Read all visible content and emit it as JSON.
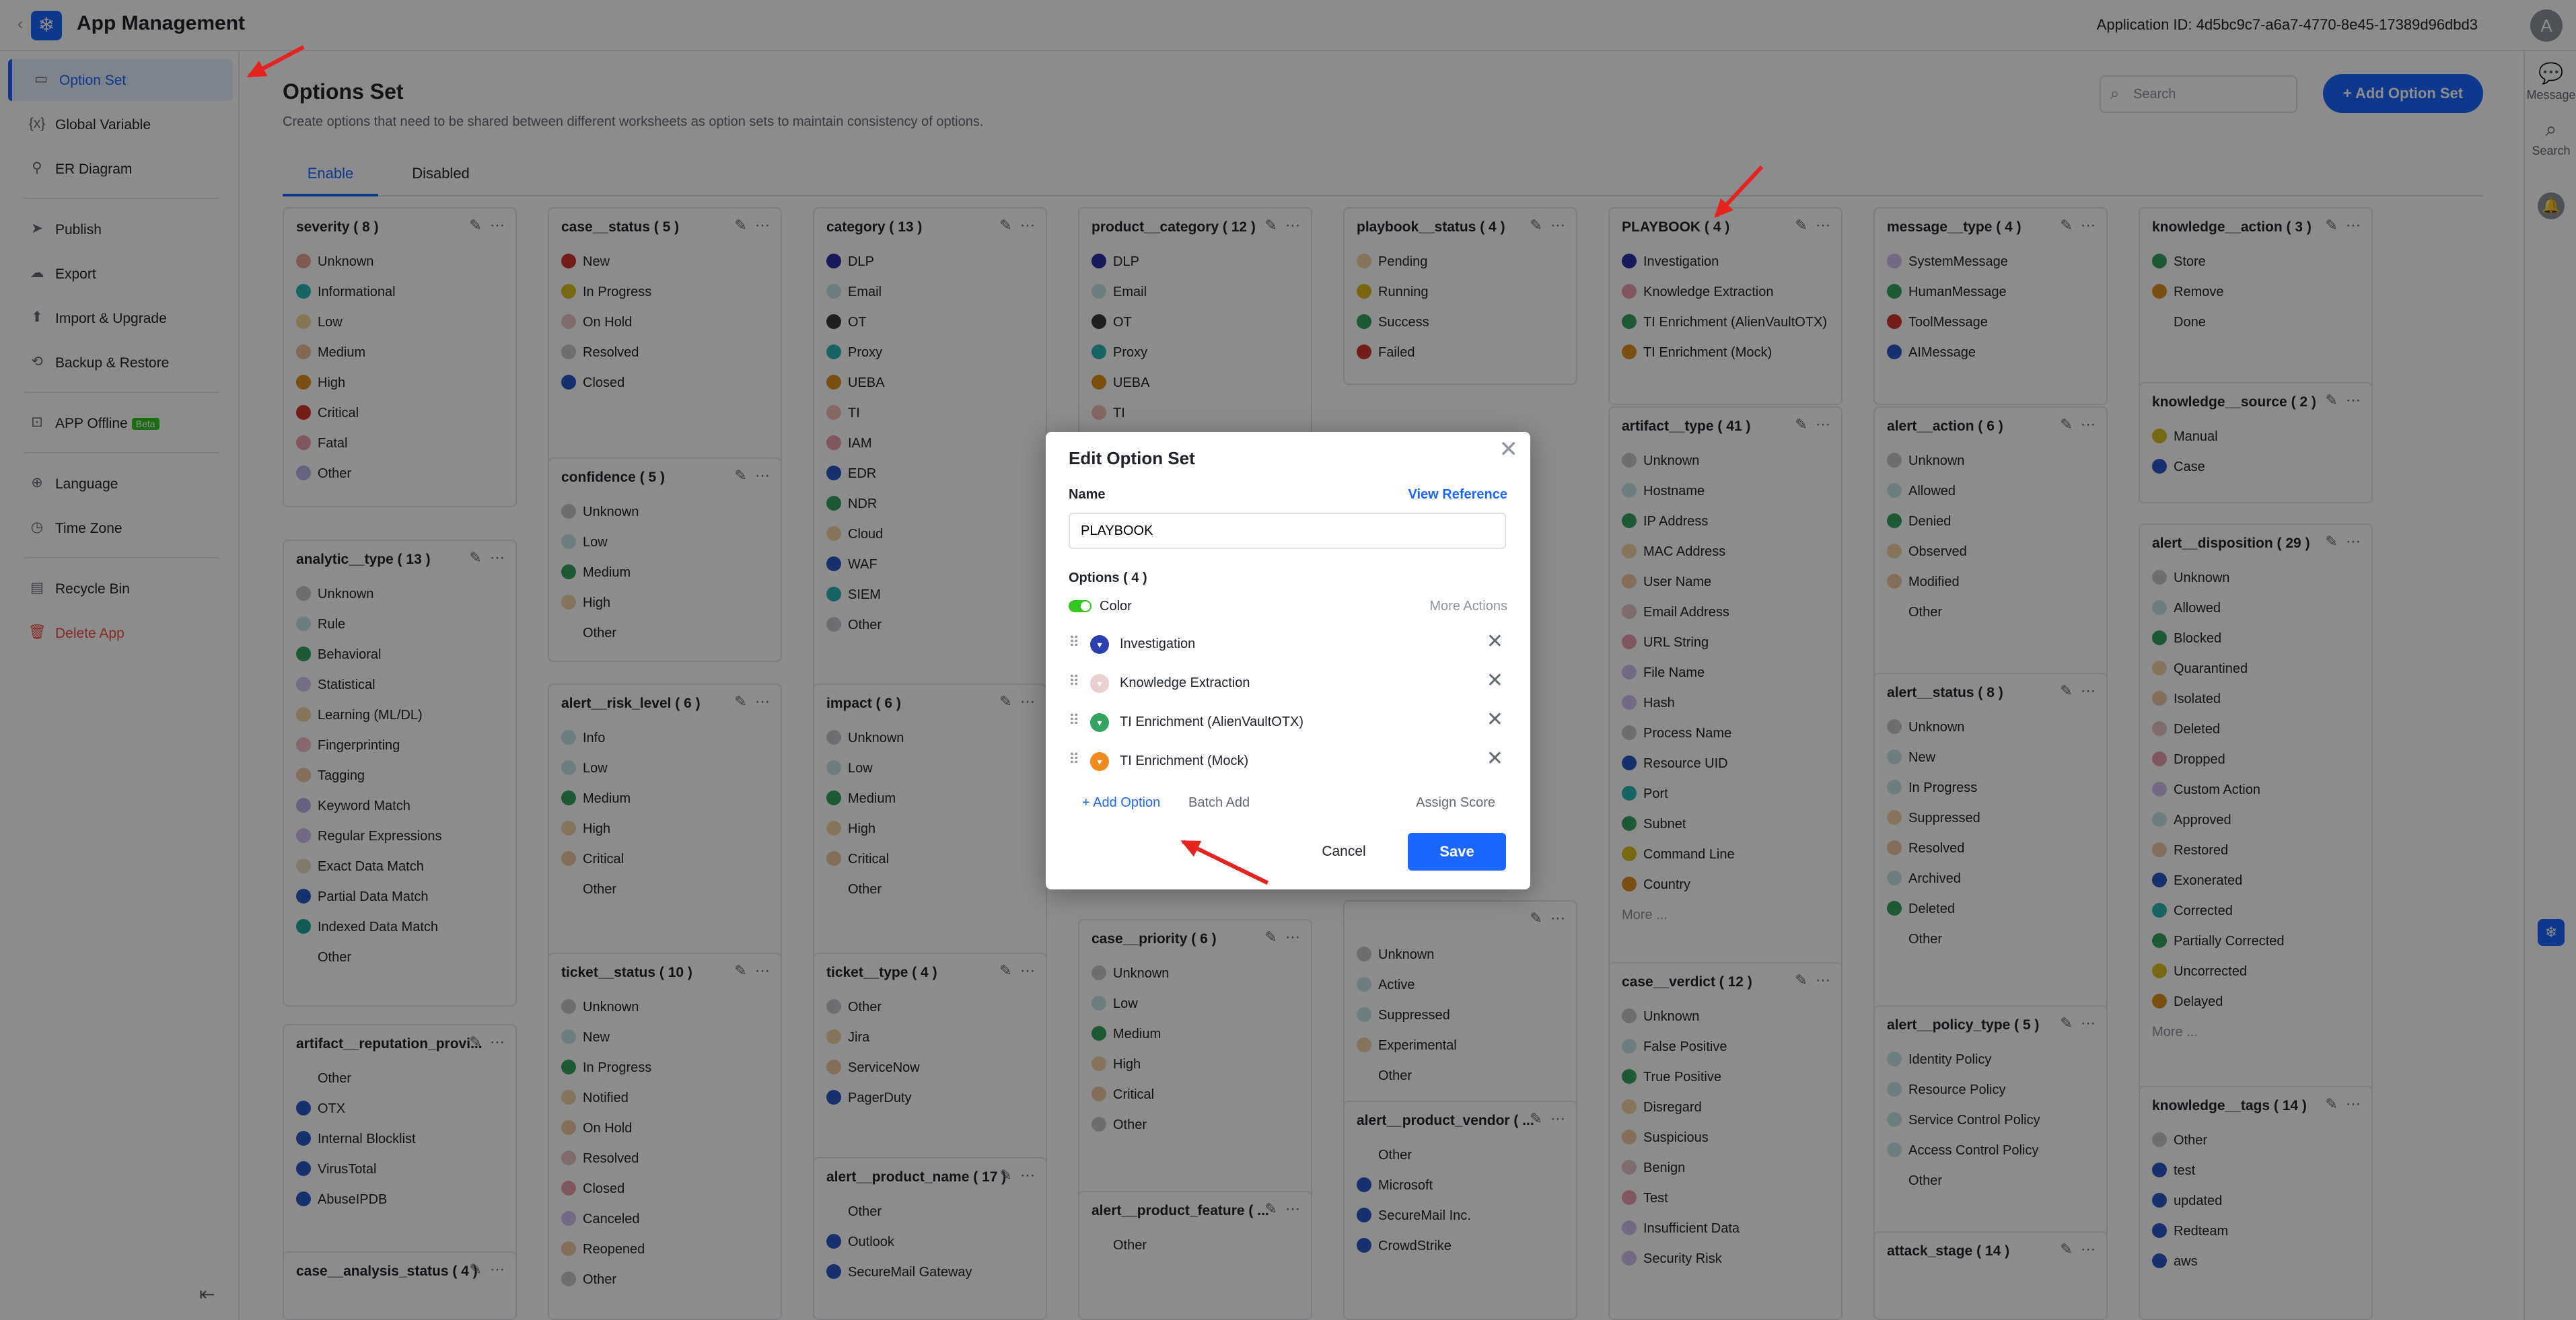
{
  "app": {
    "back": "‹",
    "logo": "❄",
    "title": "App Management",
    "app_id": "Application ID: 4d5bc9c7-a6a7-4770-8e45-17389d96dbd3",
    "avatar": "A"
  },
  "sidebar": {
    "items": [
      {
        "label": "Option Set",
        "icon": "▭"
      },
      {
        "label": "Global Variable",
        "icon": "{x}"
      },
      {
        "label": "ER Diagram",
        "icon": "⚲"
      },
      {
        "label": "Publish",
        "icon": "➤"
      },
      {
        "label": "Export",
        "icon": "☁"
      },
      {
        "label": "Import & Upgrade",
        "icon": "⬆"
      },
      {
        "label": "Backup & Restore",
        "icon": "⟲"
      },
      {
        "label": "APP Offline",
        "icon": "⊡",
        "badge": "Beta"
      },
      {
        "label": "Language",
        "icon": "⊕"
      },
      {
        "label": "Time Zone",
        "icon": "◷"
      },
      {
        "label": "Recycle Bin",
        "icon": "▤"
      },
      {
        "label": "Delete App",
        "icon": "🗑"
      }
    ]
  },
  "rightbar": {
    "message": "Message",
    "search": "Search"
  },
  "page": {
    "title": "Options Set",
    "desc": "Create options that need to be shared between different worksheets as option sets to maintain consistency of options.",
    "search_placeholder": "Search",
    "add_btn": "+ Add Option Set",
    "tabs": [
      "Enable",
      "Disabled"
    ]
  },
  "cards": [
    {
      "title": "severity ( 8 )",
      "opts": [
        [
          "Unknown",
          "#e8a598"
        ],
        [
          "Informational",
          "#2db7b3"
        ],
        [
          "Low",
          "#f2d99a"
        ],
        [
          "Medium",
          "#eebd9a"
        ],
        [
          "High",
          "#e0901f"
        ],
        [
          "Critical",
          "#d4332b"
        ],
        [
          "Fatal",
          "#ec9fae"
        ],
        [
          "Other",
          "#b9b6e6"
        ]
      ]
    },
    {
      "title": "analytic__type ( 13 )",
      "opts": [
        [
          "Unknown",
          "#c7c9cc"
        ],
        [
          "Rule",
          "#c9e6ea"
        ],
        [
          "Behavioral",
          "#33a35f"
        ],
        [
          "Statistical",
          "#d8c9f0"
        ],
        [
          "Learning (ML/DL)",
          "#f3d6a9"
        ],
        [
          "Fingerprinting",
          "#f4c0c8"
        ],
        [
          "Tagging",
          "#f0c8a8"
        ],
        [
          "Keyword Match",
          "#b9b1e8"
        ],
        [
          "Regular Expressions",
          "#d4c2ee"
        ],
        [
          "Exact Data Match",
          "#eddcc6"
        ],
        [
          "Partial Data Match",
          "#2a59c9"
        ],
        [
          "Indexed Data Match",
          "#1ea89c"
        ],
        [
          "Other",
          ""
        ]
      ]
    },
    {
      "title": "artifact__reputation_provi...",
      "opts": [
        [
          "Other",
          ""
        ],
        [
          "OTX",
          "#2a59c9"
        ],
        [
          "Internal Blocklist",
          "#2a59c9"
        ],
        [
          "VirusTotal",
          "#2a59c9"
        ],
        [
          "AbuseIPDB",
          "#2a59c9"
        ]
      ]
    },
    {
      "title": "case__analysis_status ( 4 )",
      "opts": []
    },
    {
      "title": "case__status ( 5 )",
      "opts": [
        [
          "New",
          "#d4332b"
        ],
        [
          "In Progress",
          "#d8c020"
        ],
        [
          "On Hold",
          "#e8c6c6"
        ],
        [
          "Resolved",
          "#c7c9cc"
        ],
        [
          "Closed",
          "#2a59c9"
        ]
      ]
    },
    {
      "title": "confidence ( 5 )",
      "opts": [
        [
          "Unknown",
          "#c7c9cc"
        ],
        [
          "Low",
          "#c9e6ea"
        ],
        [
          "Medium",
          "#33a35f"
        ],
        [
          "High",
          "#f3d6a9"
        ],
        [
          "Other",
          ""
        ]
      ]
    },
    {
      "title": "alert__risk_level ( 6 )",
      "opts": [
        [
          "Info",
          "#c9e6ea"
        ],
        [
          "Low",
          "#c9e6ea"
        ],
        [
          "Medium",
          "#33a35f"
        ],
        [
          "High",
          "#f3d6a9"
        ],
        [
          "Critical",
          "#f0c8a8"
        ],
        [
          "Other",
          ""
        ]
      ]
    },
    {
      "title": "ticket__status ( 10 )",
      "opts": [
        [
          "Unknown",
          "#c7c9cc"
        ],
        [
          "New",
          "#c9e6ea"
        ],
        [
          "In Progress",
          "#33a35f"
        ],
        [
          "Notified",
          "#f3d6a9"
        ],
        [
          "On Hold",
          "#f0c8a8"
        ],
        [
          "Resolved",
          "#e8c6c6"
        ],
        [
          "Closed",
          "#ec9fae"
        ],
        [
          "Canceled",
          "#d4c2ee"
        ],
        [
          "Reopened",
          "#f0c8a8"
        ],
        [
          "Other",
          "#c7c9cc"
        ]
      ]
    },
    {
      "title": "category ( 13 )",
      "opts": [
        [
          "DLP",
          "#2a2fa8"
        ],
        [
          "Email",
          "#c9e6ea"
        ],
        [
          "OT",
          "#3a3a3a"
        ],
        [
          "Proxy",
          "#2db7b3"
        ],
        [
          "UEBA",
          "#e0901f"
        ],
        [
          "TI",
          "#f3bfb9"
        ],
        [
          "IAM",
          "#ec9fae"
        ],
        [
          "EDR",
          "#2a59c9"
        ],
        [
          "NDR",
          "#33a35f"
        ],
        [
          "Cloud",
          "#f3d6a9"
        ],
        [
          "WAF",
          "#2a59c9"
        ],
        [
          "SIEM",
          "#2db7b3"
        ],
        [
          "Other",
          "#c7c9cc"
        ]
      ]
    },
    {
      "title": "impact ( 6 )",
      "opts": [
        [
          "Unknown",
          "#c7c9cc"
        ],
        [
          "Low",
          "#c9e6ea"
        ],
        [
          "Medium",
          "#33a35f"
        ],
        [
          "High",
          "#f3d6a9"
        ],
        [
          "Critical",
          "#f0c8a8"
        ],
        [
          "Other",
          ""
        ]
      ]
    },
    {
      "title": "ticket__type ( 4 )",
      "opts": [
        [
          "Other",
          "#c7c9cc"
        ],
        [
          "Jira",
          "#f3d6a9"
        ],
        [
          "ServiceNow",
          "#f0c8a8"
        ],
        [
          "PagerDuty",
          "#2a59c9"
        ]
      ]
    },
    {
      "title": "alert__product_name ( 17 )",
      "opts": [
        [
          "Other",
          ""
        ],
        [
          "Outlook",
          "#2a59c9"
        ],
        [
          "SecureMail Gateway",
          "#2a59c9"
        ]
      ]
    },
    {
      "title": "product__category ( 12 )",
      "opts": [
        [
          "DLP",
          "#2a2fa8"
        ],
        [
          "Email",
          "#c9e6ea"
        ],
        [
          "OT",
          "#3a3a3a"
        ],
        [
          "Proxy",
          "#2db7b3"
        ],
        [
          "UEBA",
          "#e0901f"
        ],
        [
          "TI",
          "#f3bfb9"
        ]
      ]
    },
    {
      "title": "case__priority ( 6 )",
      "opts": [
        [
          "Unknown",
          "#c7c9cc"
        ],
        [
          "Low",
          "#c9e6ea"
        ],
        [
          "Medium",
          "#33a35f"
        ],
        [
          "High",
          "#f3d6a9"
        ],
        [
          "Critical",
          "#f0c8a8"
        ],
        [
          "Other",
          "#c7c9cc"
        ]
      ]
    },
    {
      "title": "alert__product_feature ( ...",
      "opts": [
        [
          "Other",
          ""
        ]
      ]
    },
    {
      "title": "playbook__status ( 4 )",
      "opts": [
        [
          "Pending",
          "#f3d6a9"
        ],
        [
          "Running",
          "#e0b820"
        ],
        [
          "Success",
          "#33a35f"
        ],
        [
          "Failed",
          "#d4332b"
        ]
      ]
    },
    {
      "title": "",
      "opts": [
        [
          "Unknown",
          "#c7c9cc"
        ],
        [
          "Active",
          "#c9e6ea"
        ],
        [
          "Suppressed",
          "#c9e6ea"
        ],
        [
          "Experimental",
          "#f3d6a9"
        ],
        [
          "Other",
          ""
        ]
      ]
    },
    {
      "title": "alert__product_vendor ( ...",
      "opts": [
        [
          "Other",
          ""
        ],
        [
          "Microsoft",
          "#2a59c9"
        ],
        [
          "SecureMail Inc.",
          "#2a59c9"
        ],
        [
          "CrowdStrike",
          "#2a59c9"
        ]
      ]
    },
    {
      "title": "PLAYBOOK ( 4 )",
      "opts": [
        [
          "Investigation",
          "#2a2fa8"
        ],
        [
          "Knowledge Extraction",
          "#ec9fae"
        ],
        [
          "TI Enrichment (AlienVaultOTX)",
          "#33a35f"
        ],
        [
          "TI Enrichment (Mock)",
          "#e0901f"
        ]
      ]
    },
    {
      "title": "artifact__type ( 41 )",
      "opts": [
        [
          "Unknown",
          "#c7c9cc"
        ],
        [
          "Hostname",
          "#c9e6ea"
        ],
        [
          "IP Address",
          "#33a35f"
        ],
        [
          "MAC Address",
          "#f3d6a9"
        ],
        [
          "User Name",
          "#f0c8a8"
        ],
        [
          "Email Address",
          "#e8c6c6"
        ],
        [
          "URL String",
          "#ec9fae"
        ],
        [
          "File Name",
          "#d4c2ee"
        ],
        [
          "Hash",
          "#d4c2ee"
        ],
        [
          "Process Name",
          "#c7c9cc"
        ],
        [
          "Resource UID",
          "#2a59c9"
        ],
        [
          "Port",
          "#2db7b3"
        ],
        [
          "Subnet",
          "#33a35f"
        ],
        [
          "Command Line",
          "#d8c020"
        ],
        [
          "Country",
          "#e0901f"
        ]
      ],
      "more": "More ..."
    },
    {
      "title": "case__verdict ( 12 )",
      "opts": [
        [
          "Unknown",
          "#c7c9cc"
        ],
        [
          "False Positive",
          "#c9e6ea"
        ],
        [
          "True Positive",
          "#33a35f"
        ],
        [
          "Disregard",
          "#f3d6a9"
        ],
        [
          "Suspicious",
          "#f0c8a8"
        ],
        [
          "Benign",
          "#e8c6c6"
        ],
        [
          "Test",
          "#ec9fae"
        ],
        [
          "Insufficient Data",
          "#d4c2ee"
        ],
        [
          "Security Risk",
          "#d4c2ee"
        ]
      ]
    },
    {
      "title": "message__type ( 4 )",
      "opts": [
        [
          "SystemMessage",
          "#d4c2ee"
        ],
        [
          "HumanMessage",
          "#33a35f"
        ],
        [
          "ToolMessage",
          "#d4332b"
        ],
        [
          "AIMessage",
          "#2a59c9"
        ]
      ]
    },
    {
      "title": "alert__action ( 6 )",
      "opts": [
        [
          "Unknown",
          "#c7c9cc"
        ],
        [
          "Allowed",
          "#c9e6ea"
        ],
        [
          "Denied",
          "#33a35f"
        ],
        [
          "Observed",
          "#f3d6a9"
        ],
        [
          "Modified",
          "#f0c8a8"
        ],
        [
          "Other",
          ""
        ]
      ]
    },
    {
      "title": "alert__status ( 8 )",
      "opts": [
        [
          "Unknown",
          "#c7c9cc"
        ],
        [
          "New",
          "#c9e6ea"
        ],
        [
          "In Progress",
          "#c9e6ea"
        ],
        [
          "Suppressed",
          "#f3d6a9"
        ],
        [
          "Resolved",
          "#f0c8a8"
        ],
        [
          "Archived",
          "#c9e6ea"
        ],
        [
          "Deleted",
          "#33a35f"
        ],
        [
          "Other",
          ""
        ]
      ]
    },
    {
      "title": "alert__policy_type ( 5 )",
      "opts": [
        [
          "Identity Policy",
          "#c9e6ea"
        ],
        [
          "Resource Policy",
          "#c9e6ea"
        ],
        [
          "Service Control Policy",
          "#c9e6ea"
        ],
        [
          "Access Control Policy",
          "#c9e6ea"
        ],
        [
          "Other",
          ""
        ]
      ]
    },
    {
      "title": "attack_stage ( 14 )",
      "opts": []
    },
    {
      "title": "knowledge__action ( 3 )",
      "opts": [
        [
          "Store",
          "#33a35f"
        ],
        [
          "Remove",
          "#e0901f"
        ],
        [
          "Done",
          ""
        ]
      ]
    },
    {
      "title": "knowledge__source ( 2 )",
      "opts": [
        [
          "Manual",
          "#d8c020"
        ],
        [
          "Case",
          "#2a59c9"
        ]
      ]
    },
    {
      "title": "alert__disposition ( 29 )",
      "opts": [
        [
          "Unknown",
          "#c7c9cc"
        ],
        [
          "Allowed",
          "#c9e6ea"
        ],
        [
          "Blocked",
          "#33a35f"
        ],
        [
          "Quarantined",
          "#f3d6a9"
        ],
        [
          "Isolated",
          "#f0c8a8"
        ],
        [
          "Deleted",
          "#e8c6c6"
        ],
        [
          "Dropped",
          "#ec9fae"
        ],
        [
          "Custom Action",
          "#d4c2ee"
        ],
        [
          "Approved",
          "#c9e6ea"
        ],
        [
          "Restored",
          "#f0c8a8"
        ],
        [
          "Exonerated",
          "#2a59c9"
        ],
        [
          "Corrected",
          "#2db7b3"
        ],
        [
          "Partially Corrected",
          "#33a35f"
        ],
        [
          "Uncorrected",
          "#d8c020"
        ],
        [
          "Delayed",
          "#e0901f"
        ]
      ],
      "more": "More ..."
    },
    {
      "title": "knowledge__tags ( 14 )",
      "opts": [
        [
          "Other",
          "#c7c9cc"
        ],
        [
          "test",
          "#2a59c9"
        ],
        [
          "updated",
          "#2a59c9"
        ],
        [
          "Redteam",
          "#2a59c9"
        ],
        [
          "aws",
          "#2a59c9"
        ]
      ]
    }
  ],
  "modal": {
    "title": "Edit Option Set",
    "close": "✕",
    "name_label": "Name",
    "view_reference": "View Reference",
    "name_value": "PLAYBOOK",
    "options_label": "Options ( 4 )",
    "color_label": "Color",
    "more_actions": "More Actions",
    "options": [
      {
        "label": "Investigation",
        "color": "#2a3fb0"
      },
      {
        "label": "Knowledge Extraction",
        "color": "#e6d0d0"
      },
      {
        "label": "TI Enrichment (AlienVaultOTX)",
        "color": "#33a35f"
      },
      {
        "label": "TI Enrichment (Mock)",
        "color": "#f08a1c"
      }
    ],
    "add_option": "+ Add Option",
    "batch_add": "Batch Add",
    "assign_score": "Assign Score",
    "cancel": "Cancel",
    "save": "Save"
  }
}
